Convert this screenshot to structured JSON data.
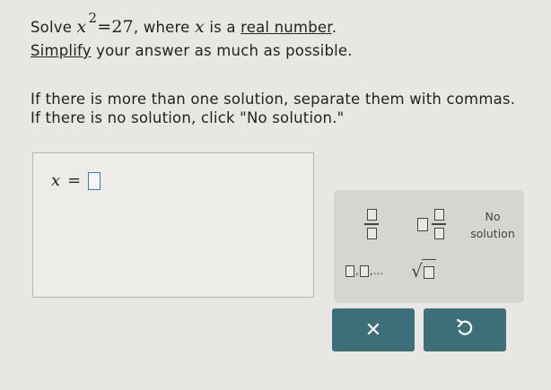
{
  "problem": {
    "solve_prefix": "Solve",
    "equation_lhs": "x",
    "equation_exp": "2",
    "equation_rhs": "=27",
    "where_prefix": ", where",
    "variable": "x",
    "is_a": "is a",
    "real_number_link": "real number",
    "period": ".",
    "simplify_link": "Simplify",
    "simplify_rest": "your answer as much as possible.",
    "instruction_multiple": "If there is more than one solution, separate them with commas.",
    "instruction_none": "If there is no solution, click \"No solution.\""
  },
  "answer": {
    "variable": "x",
    "equals": "="
  },
  "palette": {
    "no_solution_line1": "No",
    "no_solution_line2": "solution",
    "list_separator": ",",
    "list_ellipsis": ",..."
  },
  "actions": {
    "clear_symbol": "✕"
  },
  "colors": {
    "action_button": "#3c6f77",
    "input_focus": "#3a7bd5",
    "palette_bg": "#d7d5d1"
  },
  "icons": {
    "fraction": "fraction-icon",
    "mixed_number": "mixed-number-icon",
    "list": "list-icon",
    "square_root": "square-root-icon",
    "clear": "close-icon",
    "undo": "undo-icon"
  }
}
